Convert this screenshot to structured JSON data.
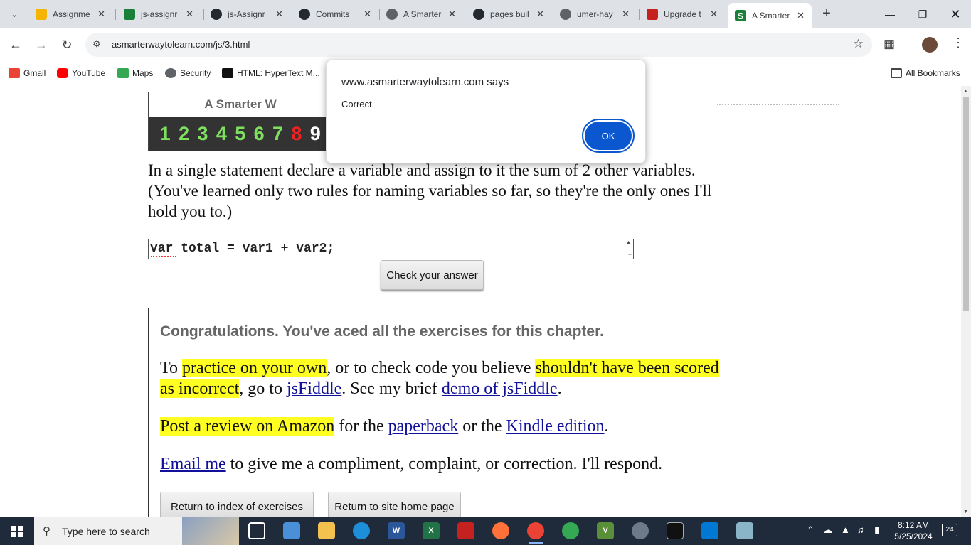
{
  "browser": {
    "tabs": [
      {
        "title": "Assignme",
        "icon": "classroom-icon",
        "color": "#f4b400"
      },
      {
        "title": "js-assignr",
        "icon": "classroom-icon",
        "color": "#188038"
      },
      {
        "title": "js-Assignr",
        "icon": "github-icon",
        "color": "#24292f"
      },
      {
        "title": "Commits",
        "icon": "github-icon",
        "color": "#24292f"
      },
      {
        "title": "A Smarter",
        "icon": "globe-icon",
        "color": "#5f6368"
      },
      {
        "title": "pages buil",
        "icon": "github-icon",
        "color": "#24292f"
      },
      {
        "title": "umer-hay",
        "icon": "globe-icon",
        "color": "#5f6368"
      },
      {
        "title": "Upgrade t",
        "icon": "recorder-icon",
        "color": "#c5221f"
      },
      {
        "title": "A Smarter",
        "icon": "s-logo-icon",
        "color": "#188038",
        "active": true
      }
    ],
    "url": "asmarterwaytolearn.com/js/3.html",
    "bookmarks": [
      {
        "label": "Gmail",
        "icon": "gmail-icon",
        "color": "#ea4335"
      },
      {
        "label": "YouTube",
        "icon": "youtube-icon",
        "color": "#ff0000"
      },
      {
        "label": "Maps",
        "icon": "maps-icon",
        "color": "#34a853"
      },
      {
        "label": "Security",
        "icon": "globe-icon",
        "color": "#5f6368"
      },
      {
        "label": "HTML: HyperText M...",
        "icon": "mdn-icon",
        "color": "#111111"
      }
    ],
    "all_bookmarks": "All Bookmarks"
  },
  "page": {
    "header_title": "A Smarter W",
    "exercise_numbers": [
      "1",
      "2",
      "3",
      "4",
      "5",
      "6",
      "7",
      "8",
      "9"
    ],
    "current_exercise": "8",
    "instructions": "In a single statement declare a variable and assign to it the sum of 2 other variables. (You've learned only two rules for naming variables so far, so they're the only ones I'll hold you to.)",
    "answer_value": "var total = var1 + var2;",
    "check_button": "Check your answer",
    "congrats_title": "Congratulations. You've aced all the exercises for this chapter.",
    "para1": {
      "t1": "To ",
      "h1": "practice on your own",
      "t2": ", or to check code you believe ",
      "h2": "shouldn't have been scored as incorrect",
      "t3": ", go to ",
      "l1": "jsFiddle",
      "t4": ". See my brief ",
      "l2": "demo of jsFiddle",
      "t5": "."
    },
    "para2": {
      "h1": "Post a review on Amazon",
      "t1": " for the ",
      "l1": "paperback",
      "t2": " or the ",
      "l2": "Kindle edition",
      "t3": "."
    },
    "para3": {
      "l1": "Email me",
      "t1": " to give me a compliment, complaint, or correction. I'll respond."
    },
    "return_index": "Return to index of exercises",
    "return_home": "Return to site home page"
  },
  "dialog": {
    "title": "www.asmarterwaytolearn.com says",
    "message": "Correct",
    "ok": "OK"
  },
  "taskbar": {
    "search_placeholder": "Type here to search",
    "time": "8:12 AM",
    "date": "5/25/2024",
    "notifications": "24"
  },
  "colors": {
    "highlight": "#ffff22",
    "link": "#10109a",
    "done_number": "#7fe060",
    "current_number": "#ee2222",
    "dialog_button": "#0b57d0"
  }
}
